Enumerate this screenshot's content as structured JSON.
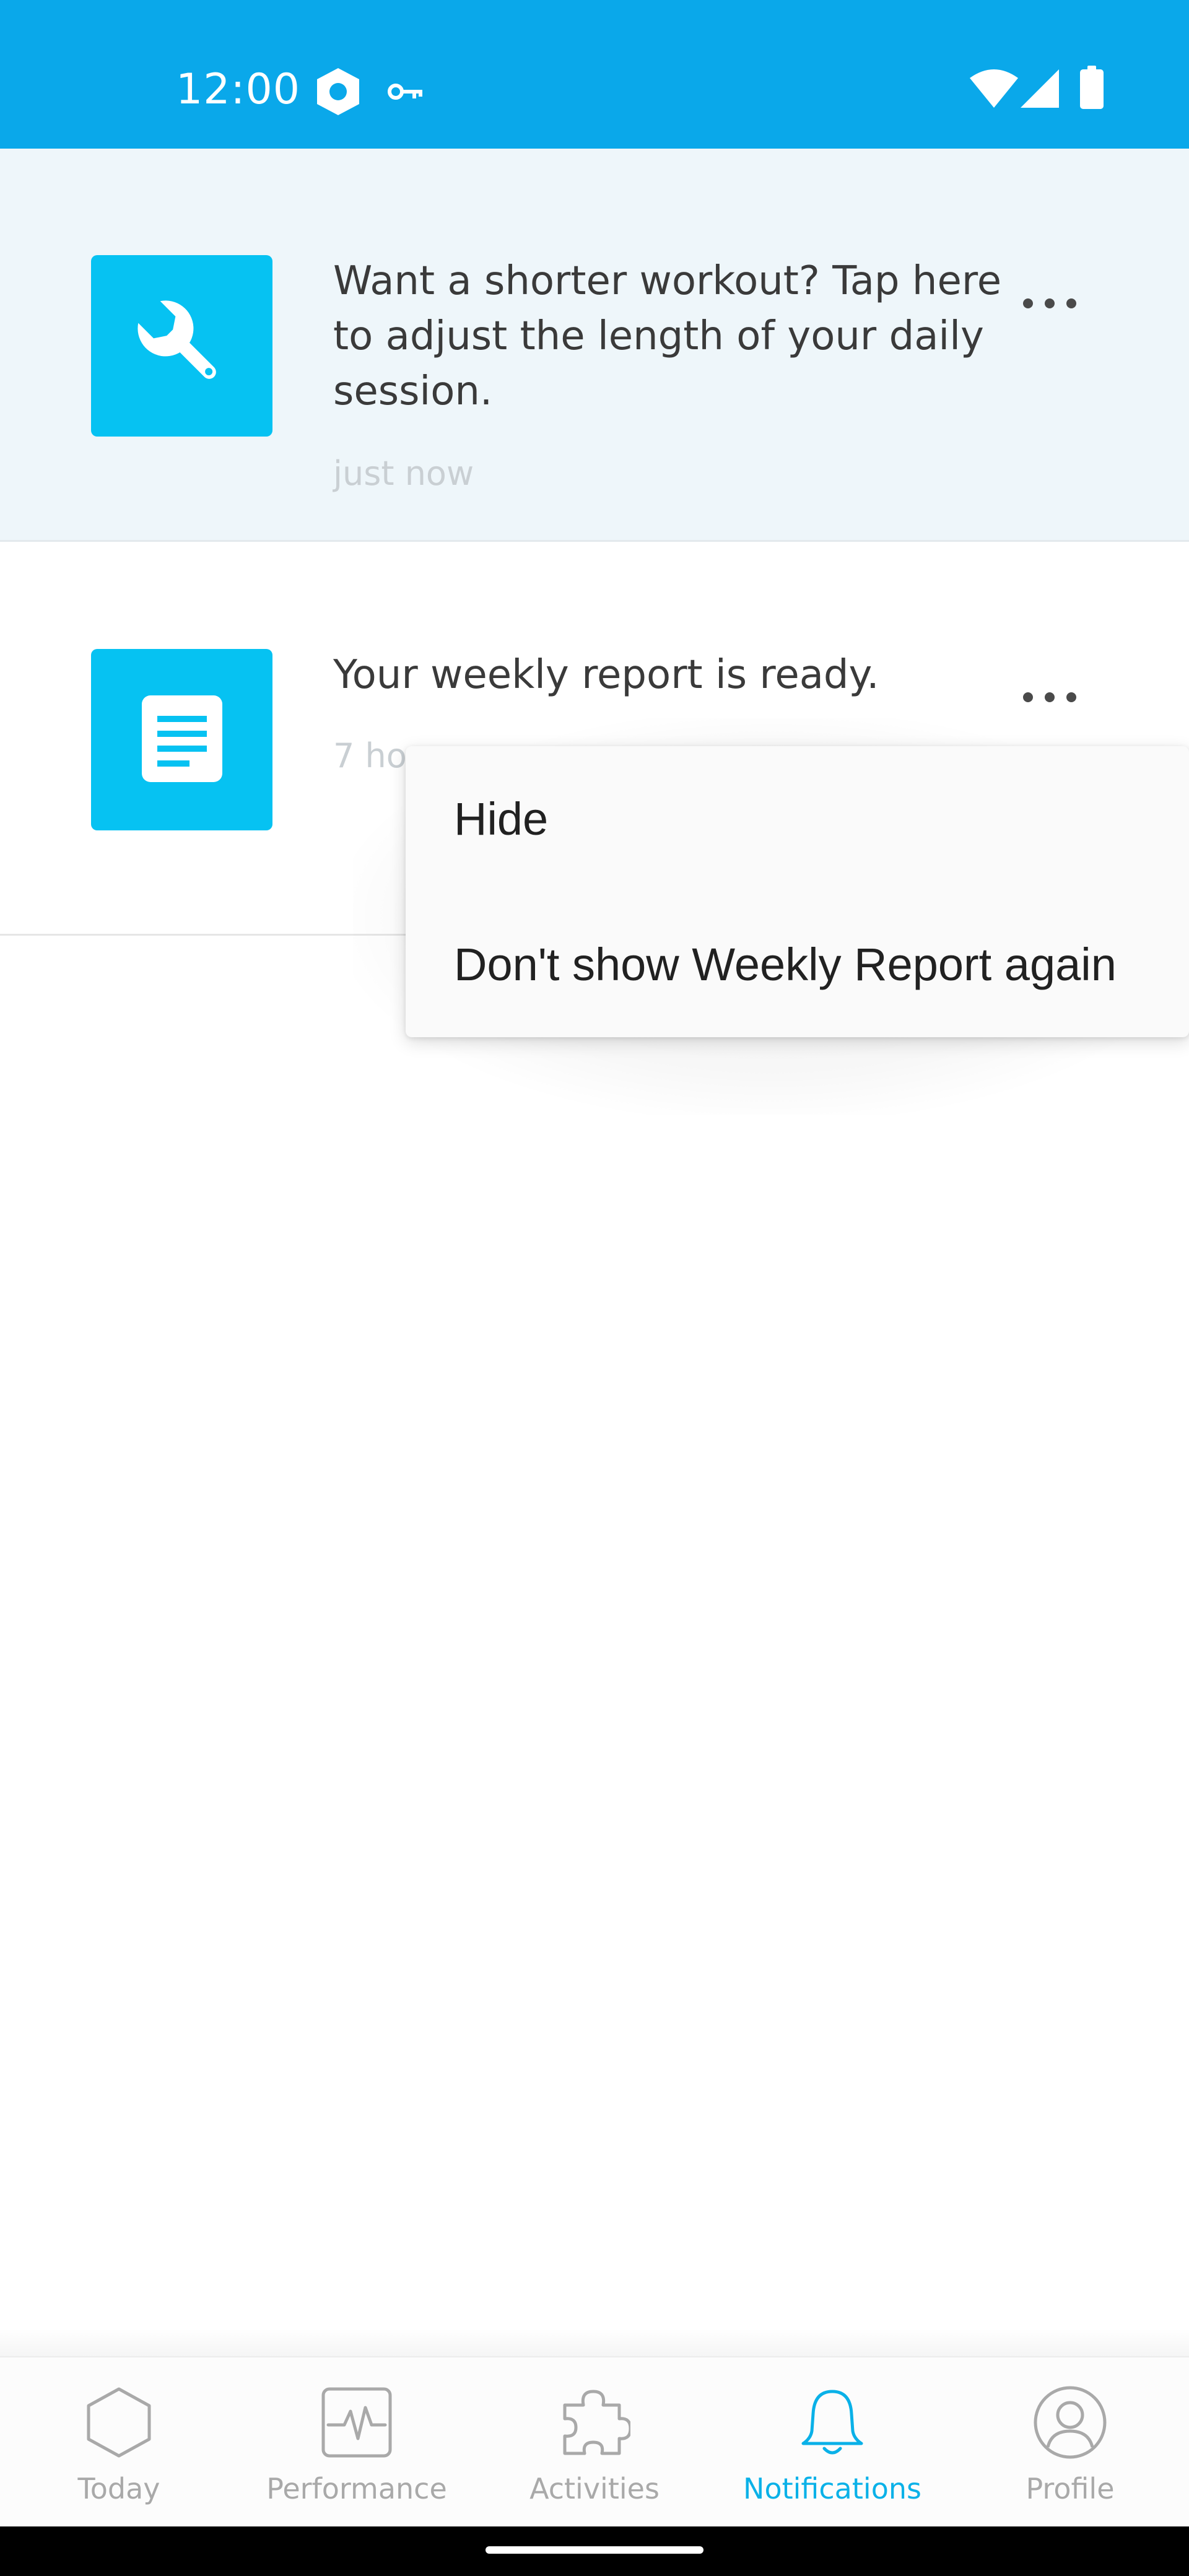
{
  "status_bar": {
    "time": "12:00",
    "left_icons": [
      "shield-lock-icon",
      "key-icon"
    ],
    "right_icons": [
      "wifi-icon",
      "cell-signal-icon",
      "battery-icon"
    ],
    "background": "#0aa8ea"
  },
  "notifications": [
    {
      "icon": "wrench-icon",
      "text": "Want a shorter workout? Tap here to adjust the length of your daily session.",
      "time": "just now",
      "unread": true
    },
    {
      "icon": "report-icon",
      "text": "Your weekly report is ready.",
      "time": "7 ho",
      "unread": false
    }
  ],
  "popup_menu": {
    "items": [
      {
        "label": "Hide"
      },
      {
        "label": "Don't show Weekly Report again"
      }
    ]
  },
  "bottom_nav": {
    "items": [
      {
        "label": "Today",
        "icon": "hexagon-icon",
        "active": false
      },
      {
        "label": "Performance",
        "icon": "pulse-chart-icon",
        "active": false
      },
      {
        "label": "Activities",
        "icon": "puzzle-icon",
        "active": false
      },
      {
        "label": "Notifications",
        "icon": "bell-icon",
        "active": true
      },
      {
        "label": "Profile",
        "icon": "user-icon",
        "active": false
      }
    ]
  },
  "colors": {
    "accent": "#0ab1e8",
    "tile": "#06c2f2",
    "inactive": "#a9a9a9"
  }
}
